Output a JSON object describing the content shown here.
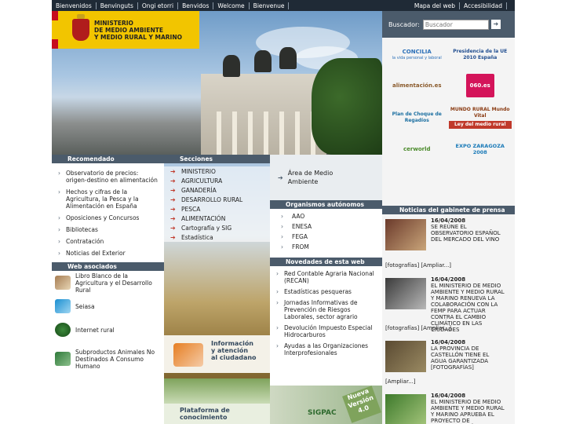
{
  "topbar": {
    "languages": [
      "Bienvenidos",
      "Benvinguts",
      "Ongi etorri",
      "Benvidos",
      "Welcome",
      "Bienvenue"
    ],
    "utilities": [
      "Mapa del web",
      "Accesibilidad"
    ]
  },
  "header": {
    "ministry_line1": "MINISTERIO",
    "ministry_line2": "DE MEDIO AMBIENTE",
    "ministry_line3": "Y MEDIO RURAL Y MARINO"
  },
  "search": {
    "label": "Buscador:",
    "placeholder": "Buscador"
  },
  "partner_logos": [
    {
      "name": "CONCILIA",
      "sub": "la vida personal y laboral"
    },
    {
      "name": "Presidencia de la UE 2010 España"
    },
    {
      "name": "alimentación.es"
    },
    {
      "name": "060.es"
    },
    {
      "name": "Plan de Choque de Regadíos"
    },
    {
      "name": "MUNDO RURAL Mundo Vital",
      "sub": "Ley del medio rural"
    },
    {
      "name": "cerworld"
    },
    {
      "name": "EXPO ZARAGOZA 2008"
    }
  ],
  "prensa": {
    "heading": "Noticias del gabinete de prensa",
    "items": [
      {
        "date": "16/04/2008",
        "title": "SE REÚNE EL OBSERVATORIO ESPAÑOL DEL MERCADO DEL VINO",
        "links": "[fotografías] [Ampliar...]"
      },
      {
        "date": "16/04/2008",
        "title": "EL MINISTERIO DE MEDIO AMBIENTE Y MEDIO RURAL Y MARINO RENUEVA LA COLABORACIÓN CON LA FEMP PARA ACTUAR CONTRA EL CAMBIO CLIMÁTICO EN LAS CIUDADES",
        "links": "[fotografías] [Ampliar...]"
      },
      {
        "date": "16/04/2008",
        "title": "LA PROVINCIA DE CASTELLÓN TIENE EL AGUA GARANTIZADA [fotografías]",
        "links": "[Ampliar...]"
      },
      {
        "date": "16/04/2008",
        "title": "EL MINISTERIO DE MEDIO AMBIENTE Y MEDIO RURAL Y MARINO APRUEBA EL PROYECTO DE MODERNIZACIÓN DE REGADÍOS DE SIERRA DE GÁDOR EN",
        "links": ""
      }
    ]
  },
  "recomendado": {
    "heading": "Recomendado",
    "items": [
      "Observatorio de precios: origen-destino en alimentación",
      "Hechos y cifras de la Agricultura, la Pesca y la Alimentación en España",
      "Oposiciones y Concursos",
      "Bibliotecas",
      "Contratación",
      "Noticias del Exterior"
    ]
  },
  "web_asociados": {
    "heading": "Web asociados",
    "items": [
      "Libro Blanco de la Agricultura y el Desarrollo Rural",
      "Seiasa",
      "Internet rural",
      "Subproductos Animales No Destinados A Consumo Humano"
    ]
  },
  "secciones": {
    "heading": "Secciones",
    "items": [
      "MINISTERIO",
      "AGRICULTURA",
      "GANADERÍA",
      "DESARROLLO RURAL",
      "PESCA",
      "ALIMENTACIÓN",
      "Cartografía y SIG",
      "Estadística"
    ]
  },
  "area": {
    "label": "Área de Medio Ambiente"
  },
  "organismos": {
    "heading": "Organismos autónomos",
    "items": [
      "AAO",
      "ENESA",
      "FEGA",
      "FROM"
    ]
  },
  "novedades": {
    "heading": "Novedades de esta web",
    "items": [
      "Red Contable Agraria Nacional (RECAN)",
      "Estadísticas pesqueras",
      "Jornadas Informativas de Prevención de Riesgos Laborales, sector agrario",
      "Devolución Impuesto Especial Hidrocarburos",
      "Ayudas a las Organizaciones Interprofesionales"
    ]
  },
  "banners": {
    "info_line1": "Información",
    "info_line2": "y atención",
    "info_line3": "al ciudadano",
    "plat_line1": "Plataforma de",
    "plat_line2": "conocimiento",
    "sigpac": "SIGPAC",
    "sigpac_version": "Nueva Versión 4.0"
  },
  "colors": {
    "nav_bar": "#1f2a36",
    "section_heading": "#4b5b6b",
    "logo_yellow": "#f2c500"
  }
}
